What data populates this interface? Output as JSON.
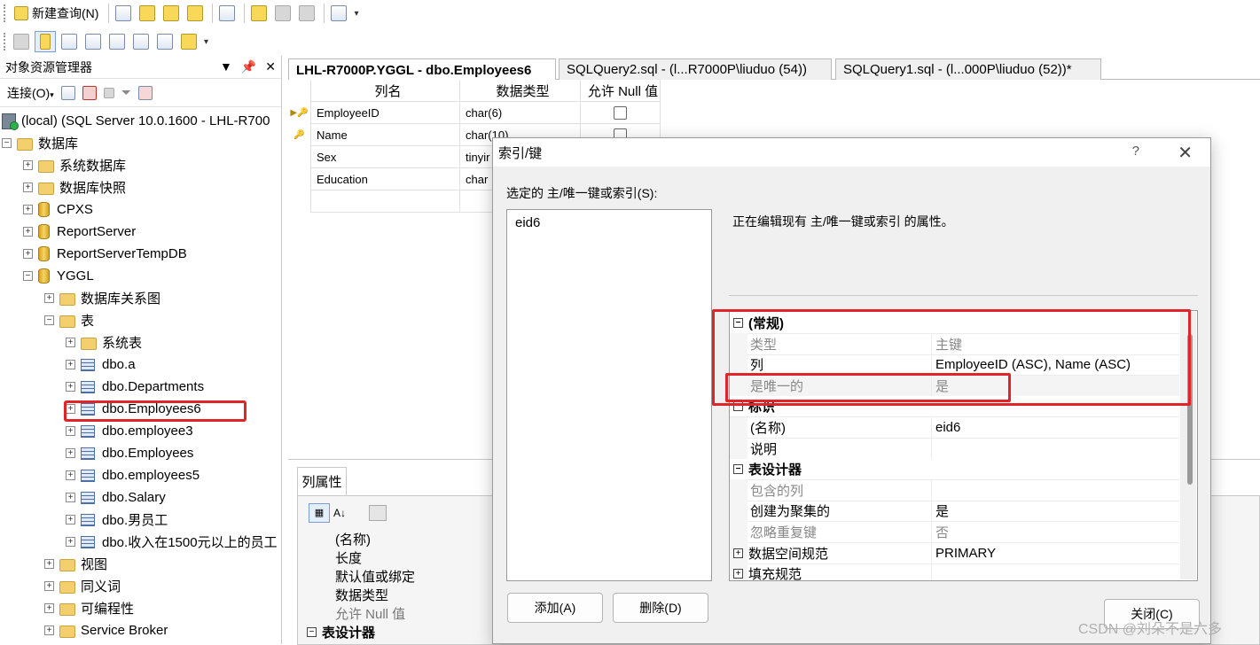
{
  "toolbar": {
    "new_query_label": "新建查询(N)",
    "icons1": [
      "database-engine-query-icon",
      "analysis-mdx-icon",
      "analysis-dmx-icon",
      "analysis-xmla-icon",
      "sql-ce-query-icon",
      "open-file-icon",
      "save-icon",
      "print-icon",
      "activity-monitor-icon"
    ],
    "icons2": [
      "generate-change-script-icon",
      "set-primary-key-icon",
      "relationships-icon",
      "manage-indexes-icon",
      "manage-fulltext-icon",
      "manage-xml-indexes-icon",
      "check-constraints-icon",
      "spatial-indexes-icon"
    ]
  },
  "object_explorer": {
    "title": "对象资源管理器",
    "connect_label": "连接(O)",
    "pin_glyph": "▼  ‸  ✕",
    "tree": [
      {
        "label": "(local) (SQL Server 10.0.1600 - LHL-R700",
        "type": "server"
      },
      {
        "label": "数据库",
        "type": "folder",
        "exp": "−"
      },
      {
        "label": "系统数据库",
        "type": "folder",
        "exp": "+"
      },
      {
        "label": "数据库快照",
        "type": "folder",
        "exp": "+"
      },
      {
        "label": "CPXS",
        "type": "db",
        "exp": "+"
      },
      {
        "label": "ReportServer",
        "type": "db",
        "exp": "+"
      },
      {
        "label": "ReportServerTempDB",
        "type": "db",
        "exp": "+"
      },
      {
        "label": "YGGL",
        "type": "db",
        "exp": "−"
      },
      {
        "label": "数据库关系图",
        "type": "folder",
        "exp": "+"
      },
      {
        "label": "表",
        "type": "folder",
        "exp": "−"
      },
      {
        "label": "系统表",
        "type": "folder",
        "exp": "+"
      },
      {
        "label": "dbo.a",
        "type": "table",
        "exp": "+"
      },
      {
        "label": "dbo.Departments",
        "type": "table",
        "exp": "+"
      },
      {
        "label": "dbo.Employees6",
        "type": "table",
        "exp": "+"
      },
      {
        "label": "dbo.employee3",
        "type": "table",
        "exp": "+"
      },
      {
        "label": "dbo.Employees",
        "type": "table",
        "exp": "+"
      },
      {
        "label": "dbo.employees5",
        "type": "table",
        "exp": "+"
      },
      {
        "label": "dbo.Salary",
        "type": "table",
        "exp": "+"
      },
      {
        "label": "dbo.男员工",
        "type": "table",
        "exp": "+"
      },
      {
        "label": "dbo.收入在1500元以上的员工",
        "type": "table",
        "exp": "+"
      },
      {
        "label": "视图",
        "type": "folder",
        "exp": "+"
      },
      {
        "label": "同义词",
        "type": "folder",
        "exp": "+"
      },
      {
        "label": "可编程性",
        "type": "folder",
        "exp": "+"
      },
      {
        "label": "Service Broker",
        "type": "folder",
        "exp": "+"
      }
    ]
  },
  "tabs": [
    {
      "label": "LHL-R7000P.YGGL - dbo.Employees6",
      "active": true
    },
    {
      "label": "SQLQuery2.sql - (l...R7000P\\liuduo (54))",
      "active": false
    },
    {
      "label": "SQLQuery1.sql - (l...000P\\liuduo (52))*",
      "active": false
    }
  ],
  "designer": {
    "headers": {
      "name": "列名",
      "type": "数据类型",
      "null": "允许 Null 值"
    },
    "rows": [
      {
        "name": "EmployeeID",
        "type": "char(6)",
        "marker": "▶🔑"
      },
      {
        "name": "Name",
        "type": "char(10)",
        "marker": "🔑"
      },
      {
        "name": "Sex",
        "type": "tinyir",
        "marker": ""
      },
      {
        "name": "Education",
        "type": "char",
        "marker": ""
      }
    ]
  },
  "column_properties": {
    "tab_label": "列属性",
    "rows": [
      {
        "label": "(名称)"
      },
      {
        "label": "长度"
      },
      {
        "label": "默认值或绑定"
      },
      {
        "label": "数据类型"
      },
      {
        "label": "允许 Null 值"
      },
      {
        "label": "表设计器"
      }
    ]
  },
  "dialog": {
    "title": "索引/键",
    "help": "?",
    "close": "✕",
    "selected_label": "选定的 主/唯一键或索引(S):",
    "list_items": [
      "eid6"
    ],
    "description": "正在编辑现有 主/唯一键或索引 的属性。",
    "property_rows": [
      {
        "key": "(常规)",
        "value": "",
        "kind": "cat",
        "exp": "−"
      },
      {
        "key": "类型",
        "value": "主键",
        "kind": "grey"
      },
      {
        "key": "列",
        "value": "EmployeeID (ASC), Name (ASC)",
        "kind": "normal"
      },
      {
        "key": "是唯一的",
        "value": "是",
        "kind": "grey"
      },
      {
        "key": "标识",
        "value": "",
        "kind": "cat",
        "exp": "−"
      },
      {
        "key": "(名称)",
        "value": "eid6",
        "kind": "normal"
      },
      {
        "key": "说明",
        "value": "",
        "kind": "normal"
      },
      {
        "key": "表设计器",
        "value": "",
        "kind": "cat",
        "exp": "−"
      },
      {
        "key": "包含的列",
        "value": "",
        "kind": "grey"
      },
      {
        "key": "创建为聚集的",
        "value": "是",
        "kind": "normal"
      },
      {
        "key": "忽略重复键",
        "value": "否",
        "kind": "grey"
      },
      {
        "key": "数据空间规范",
        "value": "PRIMARY",
        "kind": "sub",
        "exp": "+"
      },
      {
        "key": "填充规范",
        "value": "",
        "kind": "sub",
        "exp": "+"
      }
    ],
    "add_button": "添加(A)",
    "delete_button": "删除(D)",
    "close_button": "关闭(C)"
  },
  "watermark": "CSDN @刘朵不是六多",
  "colors": {
    "highlight": "#e0242a"
  }
}
